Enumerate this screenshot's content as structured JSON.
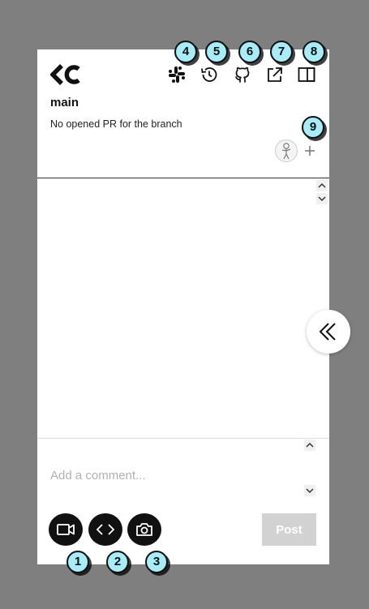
{
  "header": {
    "branch_name": "main",
    "pr_status": "No opened PR for the branch"
  },
  "icons": {
    "logo": "cc-logo-icon",
    "slack": "slack-icon",
    "history": "history-icon",
    "github": "github-icon",
    "external_link": "external-link-icon",
    "layout": "layout-icon",
    "add_reviewer": "plus-icon",
    "collapse": "double-chevron-left-icon",
    "record_video": "video-camera-icon",
    "code": "code-icon",
    "screenshot": "camera-icon"
  },
  "comment": {
    "placeholder": "Add a comment...",
    "value": "",
    "post_label": "Post"
  },
  "badges": [
    "1",
    "2",
    "3",
    "4",
    "5",
    "6",
    "7",
    "8",
    "9"
  ],
  "colors": {
    "backdrop": "#7f7f7f",
    "panel": "#ffffff",
    "tool_button": "#111111",
    "post_disabled": "#d2d2d2",
    "badge_fill": "#a8ecf8"
  }
}
